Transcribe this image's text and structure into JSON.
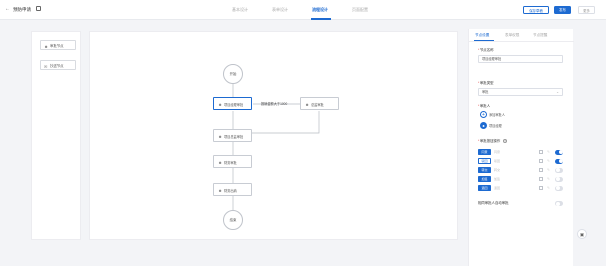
{
  "header": {
    "back_icon": "arrow-left-icon",
    "title": "预防申请",
    "edit_icon": "edit-icon",
    "steps": [
      {
        "label": "基本设计",
        "active": false
      },
      {
        "label": "表单设计",
        "active": false
      },
      {
        "label": "流程设计",
        "active": true
      },
      {
        "label": "页面配置",
        "active": false
      }
    ],
    "buttons": {
      "save_draft": "保存草稿",
      "publish": "发布",
      "more": "更多"
    }
  },
  "node_palette": {
    "items": [
      {
        "icon": "user-icon",
        "label": "审批节点"
      },
      {
        "icon": "cc-icon",
        "label": "抄送节点"
      }
    ]
  },
  "flow": {
    "start_label": "开始",
    "end_label": "结束",
    "nodes": [
      {
        "icon": "user-icon",
        "label": "项目经理审批"
      },
      {
        "icon": "user-icon",
        "label": "项目总监审批"
      },
      {
        "icon": "user-icon",
        "label": "财务审批"
      },
      {
        "icon": "user-icon",
        "label": "财务出纳"
      },
      {
        "icon": "user-icon",
        "label": "总监审批"
      }
    ],
    "condition_label": "报销金额大于1000"
  },
  "right_panel": {
    "tabs": [
      {
        "label": "节点设置",
        "active": true
      },
      {
        "label": "表单权限",
        "active": false
      },
      {
        "label": "节点提醒",
        "active": false
      }
    ],
    "node_name_label": "节点名称",
    "node_name_value": "项目经理审批",
    "approve_type_label": "审批类型",
    "approve_type_value": "审批",
    "approver_label": "审批人",
    "add_approver": "添加审批人",
    "approver_role": "项目经理",
    "operations_label": "审批按钮操作",
    "operations": [
      {
        "badge": "同意",
        "desc": "同意",
        "style": "filled",
        "enabled": true
      },
      {
        "badge": "驳回",
        "desc": "驳回",
        "style": "outline",
        "enabled": true
      },
      {
        "badge": "转交",
        "desc": "转交",
        "style": "filled",
        "enabled": false
      },
      {
        "badge": "加签",
        "desc": "加签",
        "style": "filled",
        "enabled": false
      },
      {
        "badge": "退回",
        "desc": "退回",
        "style": "filled",
        "enabled": false
      }
    ],
    "auto_label": "相同审批人自动审批"
  },
  "colors": {
    "accent": "#1d6ad1",
    "background": "#f3f4f7"
  }
}
